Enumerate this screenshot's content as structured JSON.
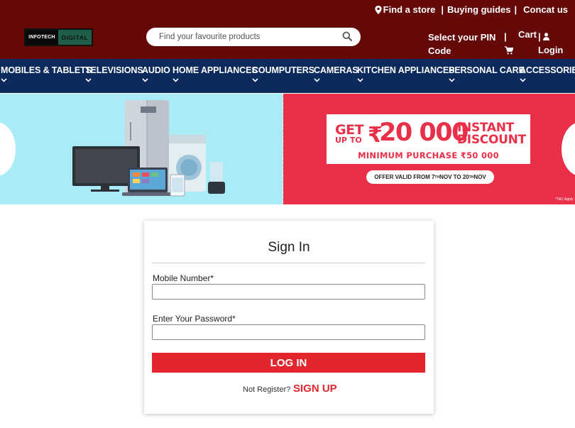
{
  "header": {
    "top_links": {
      "find_store": "Find a store",
      "separator": "|",
      "buying_guides": "Buying guides",
      "contact_us": "Concat us"
    },
    "logo": {
      "part1": "INFOTECH",
      "part2": "DIGITAL"
    },
    "search": {
      "placeholder": "Find your favourite products",
      "value": ""
    },
    "pin_code": "Select your PIN Code",
    "separator": "|",
    "cart_label": "Cart",
    "login_label": "Login",
    "colors": {
      "background": "#640808",
      "text": "#ffffff"
    }
  },
  "nav": {
    "items": [
      {
        "label": "MOBILES & TABLETS"
      },
      {
        "label": "TELEVISIONS"
      },
      {
        "label": "AUDIO"
      },
      {
        "label": "HOME APPLIANCES"
      },
      {
        "label": "COUMPUTERS"
      },
      {
        "label": "CAMERAS"
      },
      {
        "label": "KITCHEN APPLIANCES"
      },
      {
        "label": "PERSONAL CARE"
      },
      {
        "label": "ACCESSORIES"
      }
    ],
    "colors": {
      "background": "#0c2a5c"
    }
  },
  "banner": {
    "get": "GET",
    "up_to": "UP TO",
    "rupee": "₹",
    "amount": "20 000",
    "instant": "INSTANT",
    "discount": "DISCOUNT",
    "minimum_purchase": "MINIMUM PURCHASE ₹50 000",
    "valid_prefix": "OFFER VALID FROM 7",
    "valid_sup1": "TH",
    "valid_mid": " NOV TO 20",
    "valid_sup2": "TH",
    "valid_suffix": " NOV",
    "tc": "*T&C Apply",
    "colors": {
      "left_bg": "#a9ecf6",
      "right_bg": "#ea2f48"
    }
  },
  "signin": {
    "title": "Sign In",
    "mobile_label": "Mobile Number*",
    "mobile_value": "",
    "password_label": "Enter Your Password*",
    "password_value": "",
    "login_button": "LOG IN",
    "not_register": "Not Register?",
    "signup": "SIGN UP",
    "colors": {
      "accent": "#e3262d"
    }
  }
}
